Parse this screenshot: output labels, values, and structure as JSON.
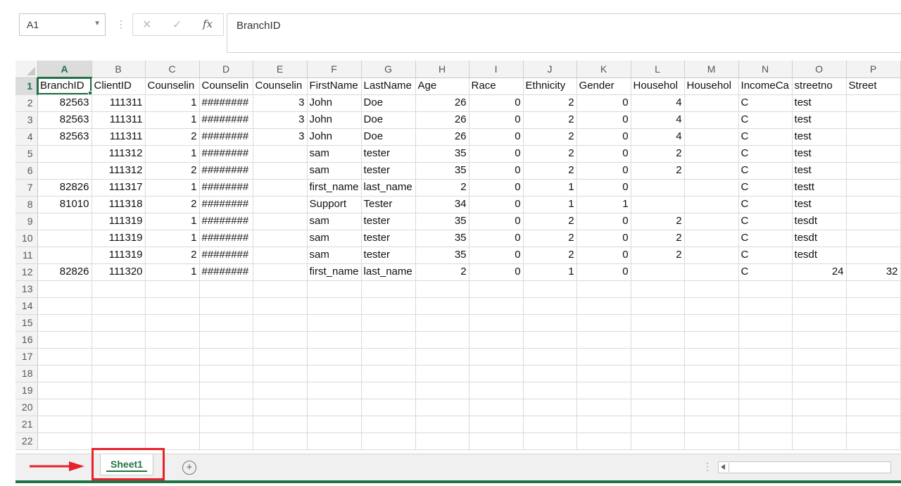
{
  "name_box": "A1",
  "formula_bar": {
    "fx_label": "fx",
    "cancel_glyph": "✕",
    "enter_glyph": "✓",
    "content": "BranchID"
  },
  "columns": [
    "A",
    "B",
    "C",
    "D",
    "E",
    "F",
    "G",
    "H",
    "I",
    "J",
    "K",
    "L",
    "M",
    "N",
    "O",
    "P"
  ],
  "rows": [
    [
      "BranchID",
      "ClientID",
      "Counselin",
      "Counselin",
      "Counselin",
      "FirstName",
      "LastName",
      "Age",
      "Race",
      "Ethnicity",
      "Gender",
      "Househol",
      "Househol",
      "IncomeCa",
      "streetno",
      "Street"
    ],
    [
      "82563",
      "111311",
      "1",
      "########",
      "3",
      "John",
      "Doe",
      "26",
      "0",
      "2",
      "0",
      "4",
      "",
      "C",
      "test",
      ""
    ],
    [
      "82563",
      "111311",
      "1",
      "########",
      "3",
      "John",
      "Doe",
      "26",
      "0",
      "2",
      "0",
      "4",
      "",
      "C",
      "test",
      ""
    ],
    [
      "82563",
      "111311",
      "2",
      "########",
      "3",
      "John",
      "Doe",
      "26",
      "0",
      "2",
      "0",
      "4",
      "",
      "C",
      "test",
      ""
    ],
    [
      "",
      "111312",
      "1",
      "########",
      "",
      "sam",
      "tester",
      "35",
      "0",
      "2",
      "0",
      "2",
      "",
      "C",
      "test",
      ""
    ],
    [
      "",
      "111312",
      "2",
      "########",
      "",
      "sam",
      "tester",
      "35",
      "0",
      "2",
      "0",
      "2",
      "",
      "C",
      "test",
      ""
    ],
    [
      "82826",
      "111317",
      "1",
      "########",
      "",
      "first_name",
      "last_name",
      "2",
      "0",
      "1",
      "0",
      "",
      "",
      "C",
      "testt",
      ""
    ],
    [
      "81010",
      "111318",
      "2",
      "########",
      "",
      "Support",
      "Tester",
      "34",
      "0",
      "1",
      "1",
      "",
      "",
      "C",
      "test",
      ""
    ],
    [
      "",
      "111319",
      "1",
      "########",
      "",
      "sam",
      "tester",
      "35",
      "0",
      "2",
      "0",
      "2",
      "",
      "C",
      "tesdt",
      ""
    ],
    [
      "",
      "111319",
      "1",
      "########",
      "",
      "sam",
      "tester",
      "35",
      "0",
      "2",
      "0",
      "2",
      "",
      "C",
      "tesdt",
      ""
    ],
    [
      "",
      "111319",
      "2",
      "########",
      "",
      "sam",
      "tester",
      "35",
      "0",
      "2",
      "0",
      "2",
      "",
      "C",
      "tesdt",
      ""
    ],
    [
      "82826",
      "111320",
      "1",
      "########",
      "",
      "first_name",
      "last_name",
      "2",
      "0",
      "1",
      "0",
      "",
      "",
      "C",
      "24",
      "32"
    ]
  ],
  "total_rows": 22,
  "sheet_tab": "Sheet1",
  "add_sheet_glyph": "+",
  "colors": {
    "excel_green": "#217346",
    "highlight_red": "#e8222a"
  }
}
